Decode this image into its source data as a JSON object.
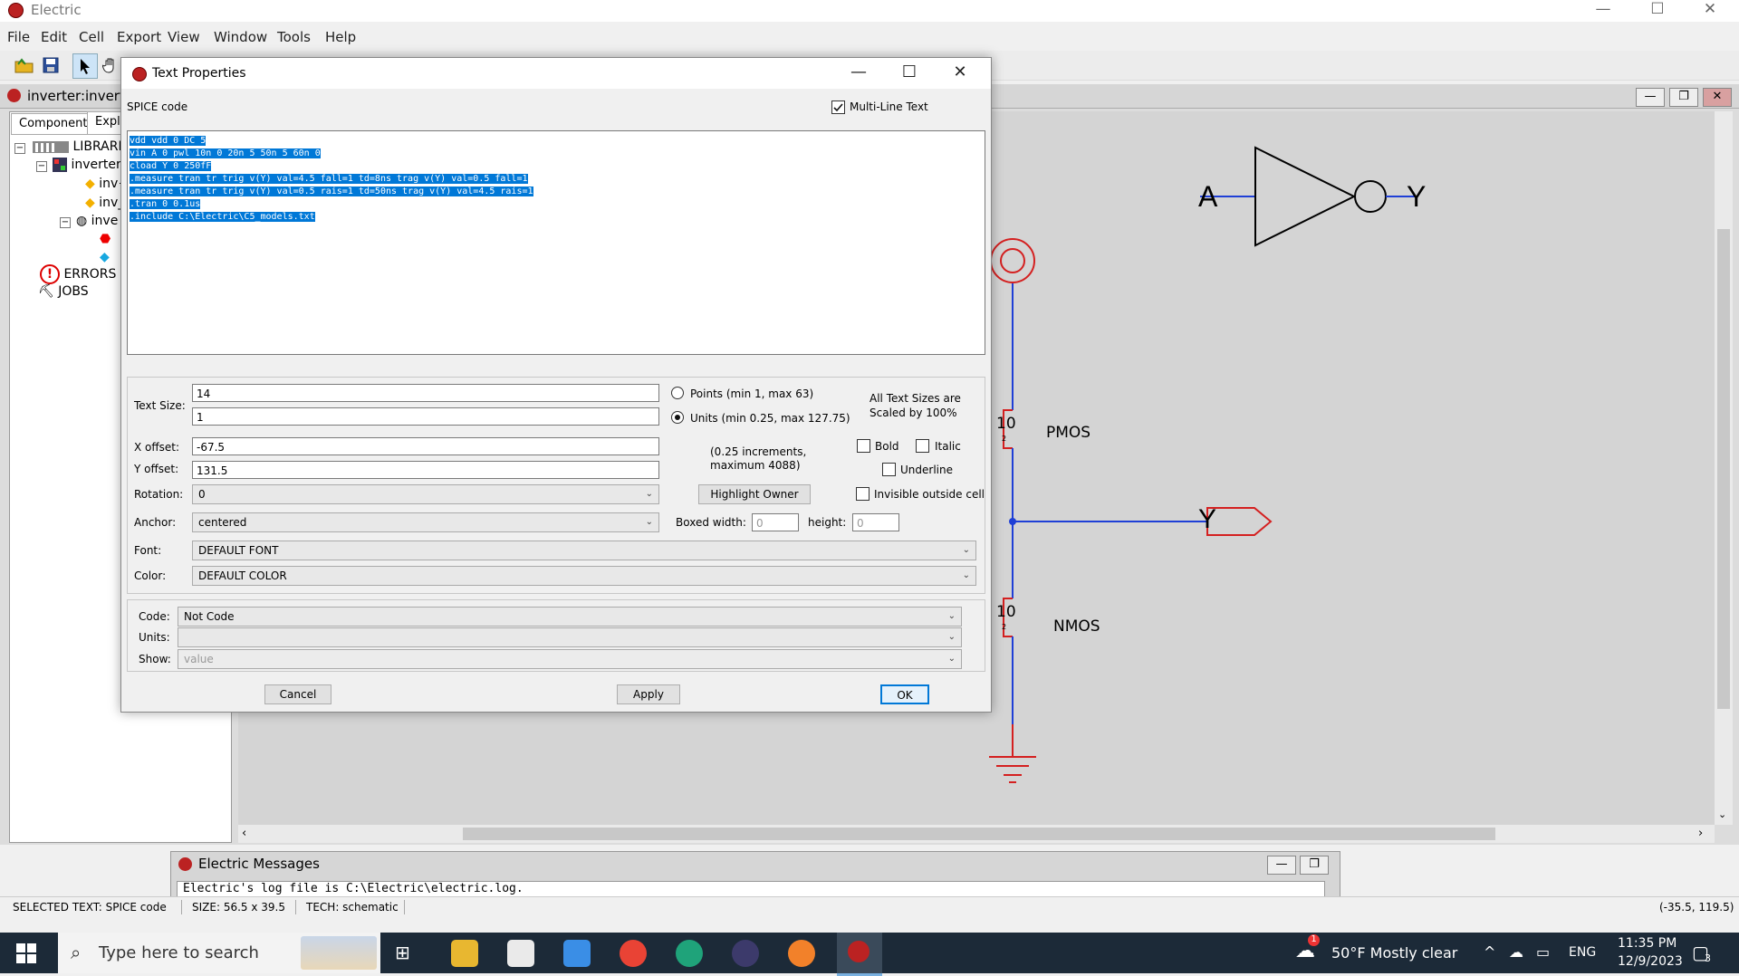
{
  "app": {
    "title": "Electric",
    "minimize": "—",
    "maximize": "☐",
    "close": "✕"
  },
  "menu": [
    "File",
    "Edit",
    "Cell",
    "Export",
    "View",
    "Window",
    "Tools",
    "Help"
  ],
  "inner_window": {
    "title": "inverter:inverter"
  },
  "explorer": {
    "tabs": [
      "Components",
      "Explor"
    ],
    "tree": [
      {
        "label": "LIBRARI",
        "toggle": "−"
      },
      {
        "label": "inverter",
        "toggle": "−"
      },
      {
        "label": "inv{",
        "toggle": ""
      },
      {
        "label": "inv_",
        "toggle": ""
      },
      {
        "label": "inve",
        "toggle": "−"
      },
      {
        "label": "",
        "toggle": ""
      },
      {
        "label": "",
        "toggle": ""
      },
      {
        "label": "ERRORS",
        "toggle": ""
      },
      {
        "label": "JOBS",
        "toggle": ""
      }
    ]
  },
  "schematic": {
    "input_label": "A",
    "output_label": "Y",
    "pmos_label": "PMOS",
    "nmos_label": "NMOS",
    "pmos_size": "10",
    "pmos_sub": "2",
    "nmos_size": "10",
    "nmos_sub": "2",
    "export_label": "Y",
    "wire_color": "#1f3fd6",
    "node_color": "#d42020"
  },
  "dialog": {
    "title": "Text Properties",
    "heading": "SPICE code",
    "multiline_label": "Multi-Line Text",
    "multiline_checked": true,
    "code_lines": [
      "vdd vdd 0 DC 5",
      "vin A 0 pwl 10n 0 20n 5 50n 5 60n 0",
      "cload Y 0 250fF",
      ".measure tran tr trig v(Y) val=4.5 fall=1 td=8ns trag v(Y) val=0.5 fall=1",
      ".measure tran tr trig v(Y) val=0.5 rais=1 td=50ns trag v(Y) val=4.5 rais=1",
      ".tran 0 0.1us",
      ".include C:\\Electric\\C5_models.txt"
    ],
    "text_size_label": "Text Size:",
    "text_size_points": "14",
    "text_size_units": "1",
    "points_label": "Points (min 1, max 63)",
    "units_label": "Units (min 0.25, max 127.75)",
    "all_sizes_note_1": "All Text Sizes are",
    "all_sizes_note_2": "Scaled by 100%",
    "x_offset_label": "X offset:",
    "x_offset": "-67.5",
    "y_offset_label": "Y offset:",
    "y_offset": "131.5",
    "increments_note_1": "(0.25 increments,",
    "increments_note_2": "maximum 4088)",
    "bold_label": "Bold",
    "italic_label": "Italic",
    "underline_label": "Underline",
    "rotation_label": "Rotation:",
    "rotation": "0",
    "highlight_owner": "Highlight Owner",
    "invisible_label": "Invisible outside cell",
    "anchor_label": "Anchor:",
    "anchor": "centered",
    "boxed_width_label": "Boxed width:",
    "boxed_width": "0",
    "height_label": "height:",
    "height": "0",
    "font_label": "Font:",
    "font": "DEFAULT FONT",
    "color_label": "Color:",
    "color": "DEFAULT COLOR",
    "code_label": "Code:",
    "code": "Not Code",
    "units_field_label": "Units:",
    "units_value": "",
    "show_label": "Show:",
    "show_value": "value",
    "cancel": "Cancel",
    "apply": "Apply",
    "ok": "OK"
  },
  "messages": {
    "title": "Electric Messages",
    "log": "Electric's log file is C:\\Electric\\electric.log."
  },
  "status": {
    "selected": "SELECTED TEXT: SPICE code",
    "size": "SIZE: 56.5 x 39.5",
    "tech": "TECH: schematic",
    "coords": "(-35.5, 119.5)"
  },
  "taskbar": {
    "search_placeholder": "Type here to search",
    "weather": "50°F  Mostly clear",
    "weather_badge": "1",
    "lang": "ENG",
    "time": "11:35 PM",
    "date": "12/9/2023",
    "notif_count": "3"
  },
  "colors": {
    "accent": "#0078d7",
    "taskbar": "#1c2a38",
    "canvas": "#d4d4d4"
  }
}
